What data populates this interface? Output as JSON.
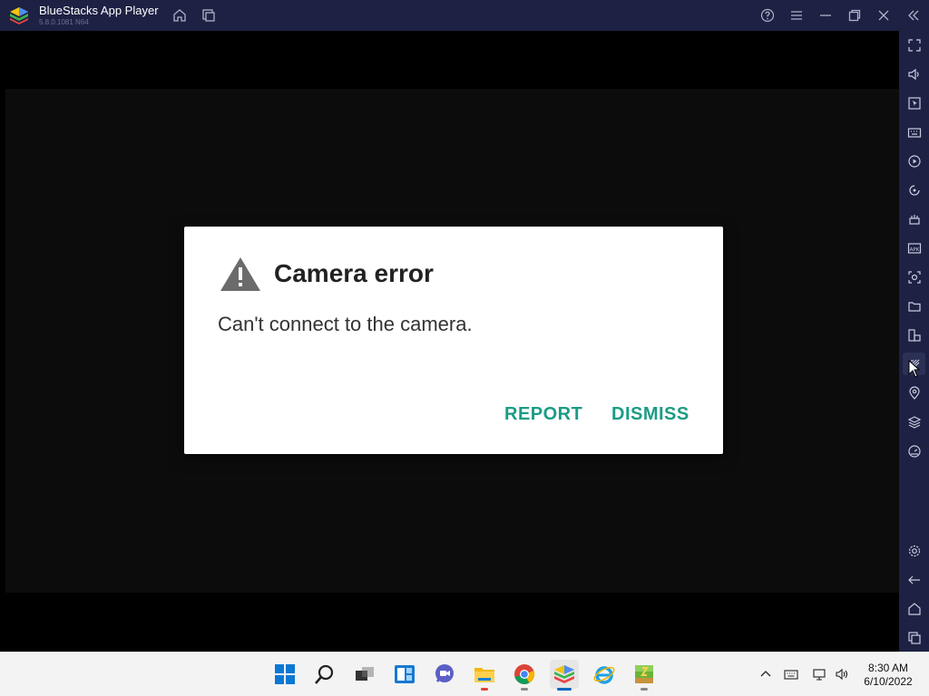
{
  "window": {
    "title": "BlueStacks App Player",
    "version": "5.8.0.1081 N64"
  },
  "titlebar_buttons": [
    {
      "name": "home-icon"
    },
    {
      "name": "multi-instance-icon"
    },
    {
      "name": "help-icon"
    },
    {
      "name": "menu-icon"
    },
    {
      "name": "minimize-icon"
    },
    {
      "name": "restore-icon"
    },
    {
      "name": "close-icon"
    },
    {
      "name": "collapse-sidebar-icon"
    }
  ],
  "sidebar_buttons": [
    "fullscreen-icon",
    "volume-icon",
    "pointer-icon",
    "keyboard-icon",
    "macro-icon",
    "rotate-icon",
    "shake-icon",
    "apk-install-icon",
    "screenshot-icon",
    "folder-icon",
    "multi-device-icon",
    "eco-mode-icon",
    "location-icon",
    "layers-icon",
    "performance-icon",
    "settings-icon",
    "back-icon",
    "home-icon",
    "recent-apps-icon"
  ],
  "dialog": {
    "title": "Camera error",
    "message": "Can't connect to the camera.",
    "report_label": "REPORT",
    "dismiss_label": "DISMISS"
  },
  "colors": {
    "accent": "#1b9c85",
    "chrome": "#1d2143"
  },
  "taskbar": {
    "apps": [
      "start-icon",
      "search-icon",
      "task-view-icon",
      "widgets-icon",
      "teams-chat-icon",
      "file-explorer-icon",
      "chrome-icon",
      "bluestacks-icon",
      "internet-explorer-icon",
      "archive-app-icon"
    ],
    "clock_time": "8:30 AM",
    "clock_date": "6/10/2022"
  }
}
